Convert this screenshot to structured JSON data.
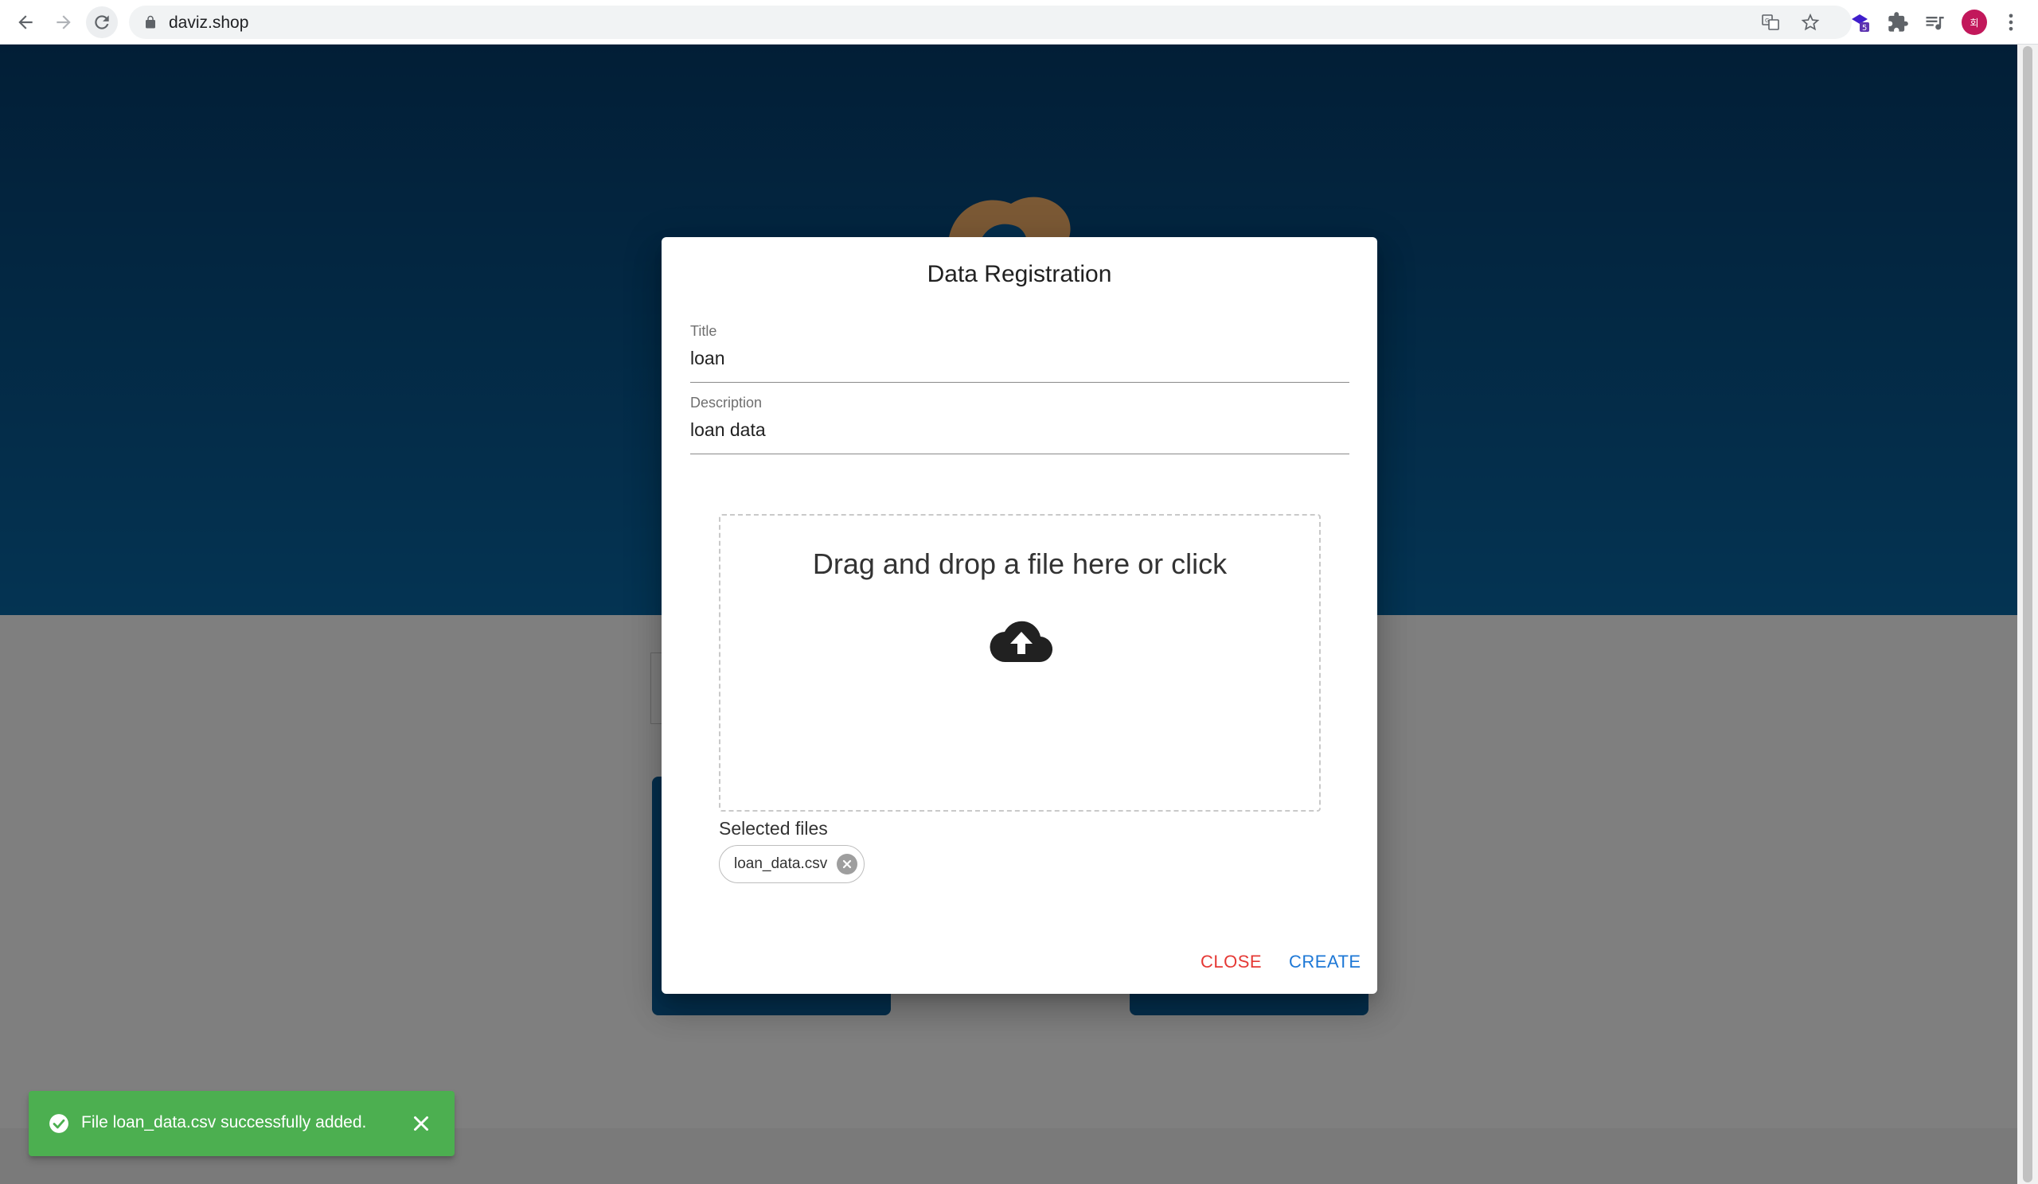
{
  "browser": {
    "url": "daviz.shop",
    "extension_badge": "5",
    "profile_initial": "회"
  },
  "dialog": {
    "title": "Data Registration",
    "title_field": {
      "label": "Title",
      "value": "loan"
    },
    "description_field": {
      "label": "Description",
      "value": "loan data"
    },
    "dropzone_text": "Drag and drop a file here or click",
    "selected_files_label": "Selected files",
    "selected_files": [
      "loan_data.csv"
    ],
    "close_label": "CLOSE",
    "create_label": "CREATE"
  },
  "snackbar": {
    "message": "File loan_data.csv successfully added."
  },
  "colors": {
    "hero": "#0968a6",
    "snackbar": "#4caf50",
    "close": "#e53935",
    "create": "#1e78d6"
  }
}
